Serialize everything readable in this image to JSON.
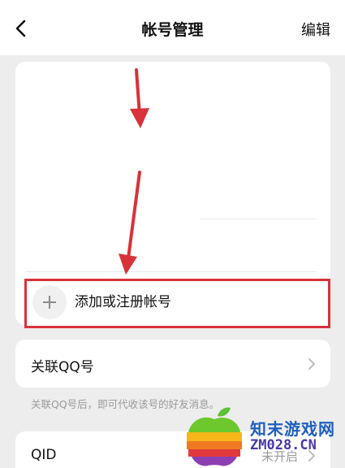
{
  "header": {
    "title": "帐号管理",
    "edit_label": "编辑"
  },
  "accounts": {
    "add_label": "添加或注册帐号"
  },
  "link_qq": {
    "label": "关联QQ号",
    "hint": "关联QQ号后，即可代收该号的好友消息。"
  },
  "qid": {
    "label": "QID",
    "status": "未开启"
  },
  "watermark": {
    "text_cn": "知末游戏网",
    "text_en": "ZM028.CN"
  },
  "colors": {
    "annotation": "#d8323a",
    "check": "#2f7cf6",
    "background": "#ededed"
  },
  "icons": {
    "back": "chevron-left-icon",
    "check": "check-icon",
    "add": "plus-icon",
    "chevron": "chevron-right-icon"
  }
}
